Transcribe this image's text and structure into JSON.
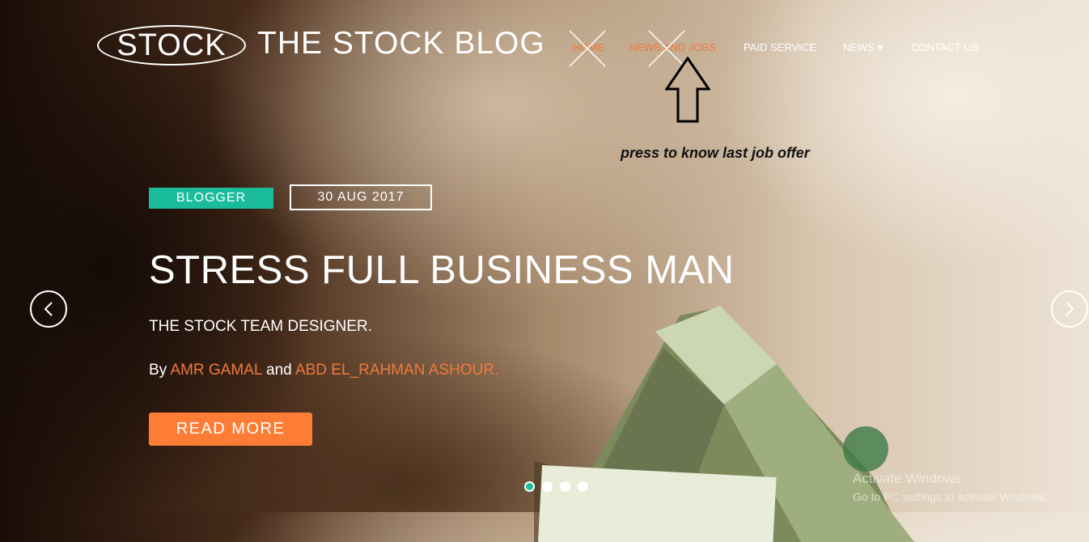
{
  "header": {
    "logo_text": "STOCK",
    "site_title": "THE STOCK BLOG",
    "nav": [
      {
        "label": "HOME"
      },
      {
        "label": "NEWS AND JOBS"
      },
      {
        "label": "PAID SERVICE"
      },
      {
        "label": "NEWS ▾"
      },
      {
        "label": "CONTACT US"
      }
    ]
  },
  "annotation": {
    "note": "press to know last job offer",
    "icons": [
      "x-mark-icon",
      "up-arrow-icon"
    ]
  },
  "hero": {
    "badge": "BLOGGER",
    "date": "30 AUG 2017",
    "headline": "STRESS FULL BUSINESS MAN",
    "subtitle": "THE STOCK TEAM DESIGNER.",
    "byline_prefix": "By ",
    "author1": "AMR GAMAL",
    "byline_and": " and ",
    "author2": "ABD EL_RAHMAN ASHOUR.",
    "cta": "READ MORE"
  },
  "carousel": {
    "prev_icon": "chevron-left-icon",
    "next_icon": "chevron-right-icon",
    "slide_count": 4,
    "active_slide": 1
  },
  "watermark": {
    "line1": "Activate Windows",
    "line2": "Go to PC settings to activate Windows."
  },
  "colors": {
    "accent_orange": "#fd7d37",
    "accent_teal": "#1abc9c"
  }
}
